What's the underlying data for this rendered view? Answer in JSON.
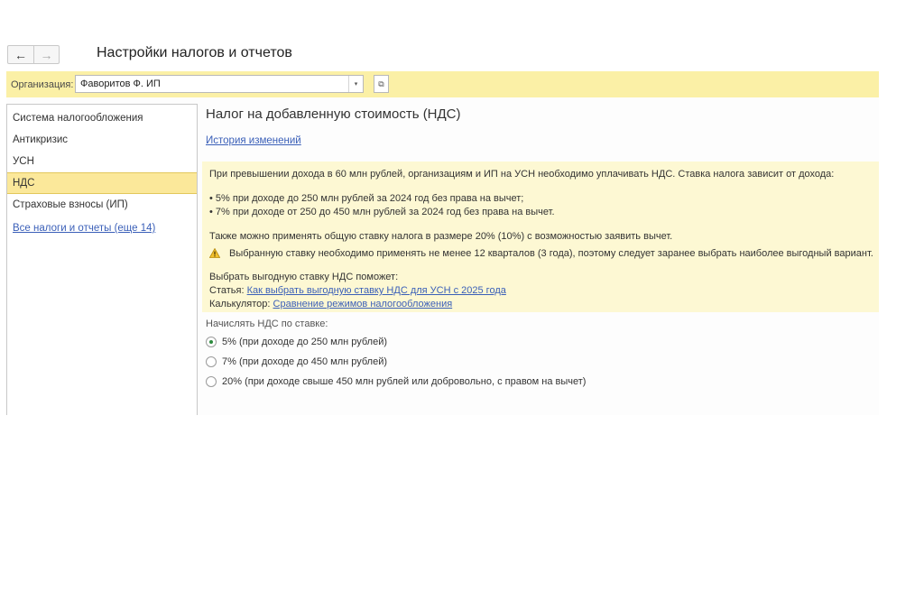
{
  "window": {
    "title": "Настройки налогов и отчетов",
    "back_icon": "←",
    "forward_icon": "→"
  },
  "organization": {
    "label": "Организация:",
    "value": "Фаворитов Ф. ИП",
    "dropdown_icon": "▾",
    "open_icon": "⧉"
  },
  "sidebar": {
    "items": [
      {
        "label": "Система налогообложения",
        "active": false
      },
      {
        "label": "Антикризис",
        "active": false
      },
      {
        "label": "УСН",
        "active": false
      },
      {
        "label": "НДС",
        "active": true
      },
      {
        "label": "Страховые взносы (ИП)",
        "active": false
      }
    ],
    "all_link": "Все налоги и отчеты (еще 14)"
  },
  "content": {
    "title": "Налог на добавленную стоимость (НДС)",
    "history_link": "История изменений",
    "info": {
      "intro": "При превышении дохода в 60 млн рублей, организациям и ИП на УСН необходимо уплачивать НДС. Ставка налога зависит от дохода:",
      "bullet_1": "• 5% при доходе до 250 млн рублей за 2024 год без права на вычет;",
      "bullet_2": "• 7% при доходе от 250 до 450 млн рублей за 2024 год без права на вычет.",
      "general_rate": "Также можно применять общую ставку налога в размере 20% (10%) с возможностью заявить вычет.",
      "warning": "Выбранную ставку необходимо применять не менее 12 кварталов (3 года), поэтому следует заранее выбрать наиболее выгодный вариант.",
      "help_title": "Выбрать выгодную ставку НДС поможет:",
      "article_label": "Статья:",
      "article_link": "Как выбрать выгодную ставку НДС для УСН с 2025 года",
      "calculator_label": "Калькулятор:",
      "calculator_link": "Сравнение режимов налогообложения"
    },
    "rate_label": "Начислять НДС по ставке:",
    "rates": [
      {
        "label": "5% (при доходе до 250 млн рублей)",
        "checked": true
      },
      {
        "label": "7% (при доходе до 450 млн рублей)",
        "checked": false
      },
      {
        "label": "20% (при доходе свыше 450 млн рублей или добровольно, с правом на вычет)",
        "checked": false
      }
    ]
  },
  "colors": {
    "accent_yellow": "#fbf0a6",
    "active_item": "#fbe89a",
    "info_background": "#fdf8d3",
    "link": "#3a5fb8",
    "radio_selected": "#2c8a3d"
  }
}
